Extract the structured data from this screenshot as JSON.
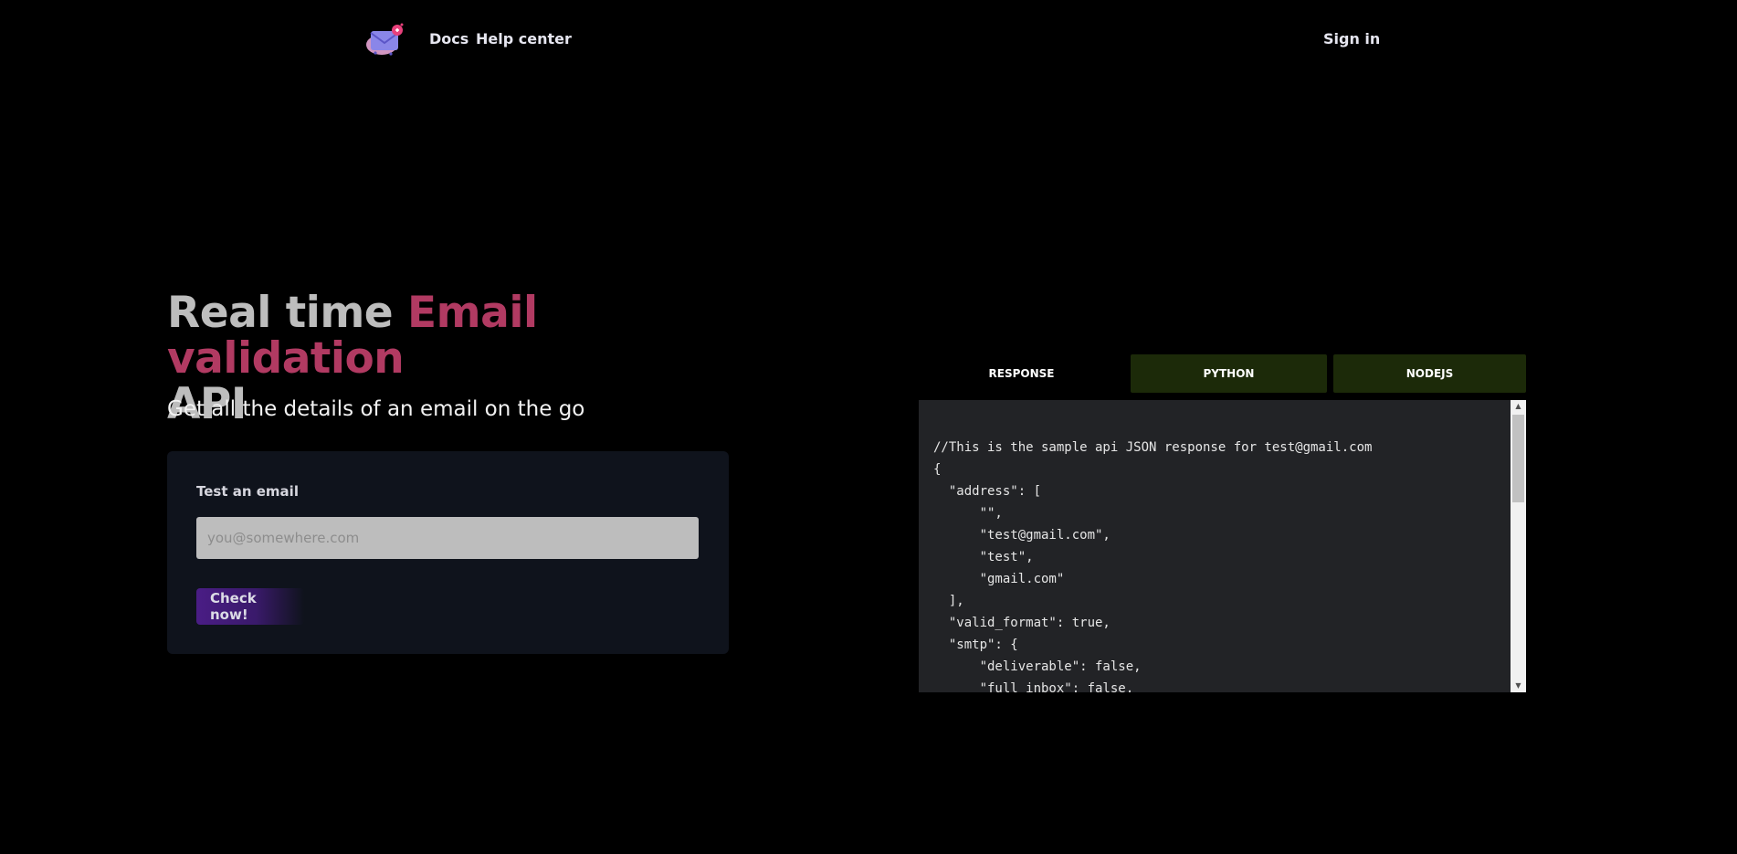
{
  "header": {
    "logo_icon": "envelope-logo-icon",
    "nav": {
      "docs": "Docs",
      "help_center": "Help center",
      "sign_in": "Sign in"
    }
  },
  "hero": {
    "title_prefix": "Real time ",
    "title_accent": "Email validation",
    "title_suffix": "API",
    "subtitle": "Get all the details of an email on the go",
    "accent_color": "#b13a62"
  },
  "test_form": {
    "label": "Test an email",
    "input_value": "",
    "input_placeholder": "you@somewhere.com",
    "button_label": "Check now!"
  },
  "code_tabs": {
    "tabs": [
      "RESPONSE",
      "PYTHON",
      "NODEJS"
    ],
    "active": "RESPONSE"
  },
  "code_panel": {
    "lines": [
      "//This is the sample api JSON response for test@gmail.com",
      "{",
      "  \"address\": [",
      "      \"\",",
      "      \"test@gmail.com\",",
      "      \"test\",",
      "      \"gmail.com\"",
      "  ],",
      "  \"valid_format\": true,",
      "  \"smtp\": {",
      "      \"deliverable\": false,",
      "      \"full_inbox\": false,"
    ]
  }
}
